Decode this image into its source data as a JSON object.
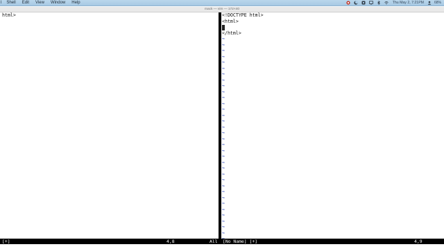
{
  "menubar": {
    "app_menu": "l",
    "items": [
      "Shell",
      "Edit",
      "View",
      "Window",
      "Help"
    ],
    "clock": "Thu May 2, 7:21PM",
    "battery": "68%",
    "status_icons": [
      "record-icon",
      "moon-icon",
      "volume-icon",
      "screen-icon",
      "bluetooth-icon",
      "wifi-icon"
    ]
  },
  "window": {
    "title": "mack — vim — 172×40"
  },
  "left_pane": {
    "lines": [
      "html>"
    ]
  },
  "right_pane": {
    "lines": [
      "<!DOCTYPE html>",
      "<html>",
      "",
      "</html>"
    ],
    "tilde_count": 35,
    "tilde_char": "~"
  },
  "statusline": {
    "left_name": "[+]",
    "left_pos": "4,8",
    "left_scroll": "All",
    "right_name": "[No Name] [+]",
    "right_pos": "4,9"
  },
  "colors": {
    "menubar": "#a7c9e4",
    "tilde": "#1f3bb5",
    "statusline_bg": "#000000",
    "statusline_fg": "#ffffff"
  }
}
